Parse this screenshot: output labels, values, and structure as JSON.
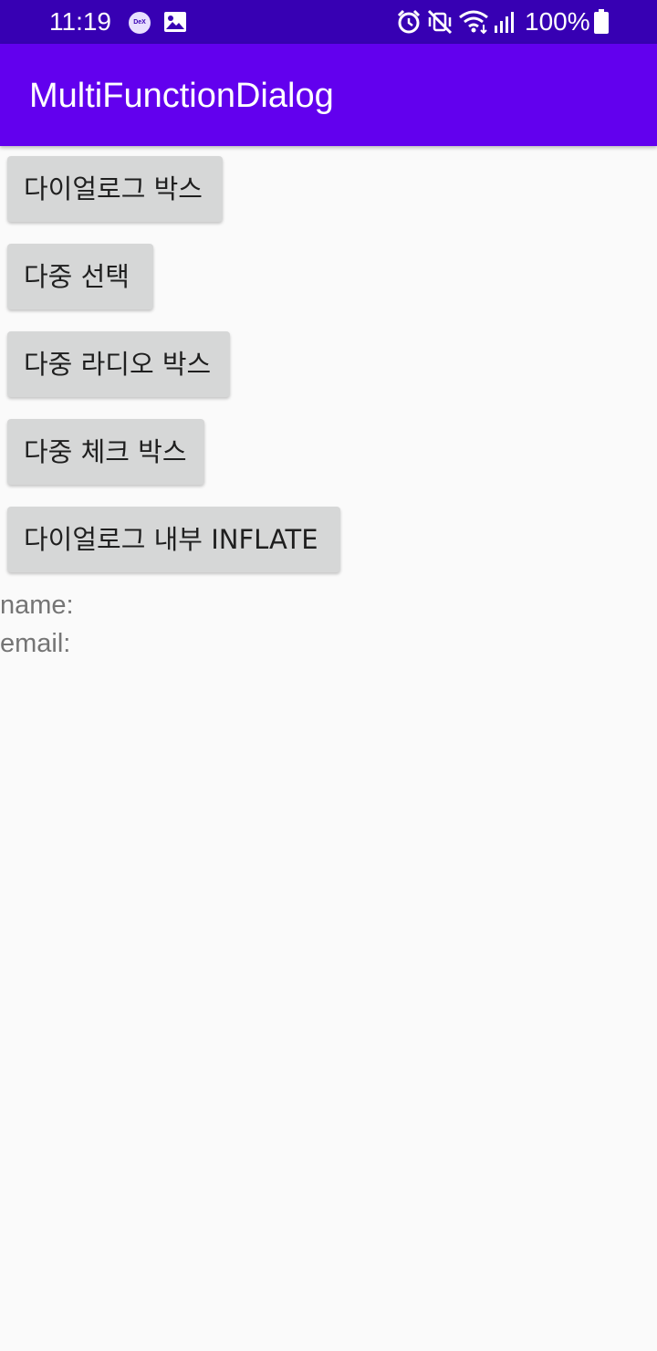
{
  "status_bar": {
    "time": "11:19",
    "dex_label": "DeX",
    "battery": "100%",
    "bg_color": "#3700b3"
  },
  "app_bar": {
    "title": "MultiFunctionDialog",
    "bg_color": "#6200ee"
  },
  "buttons": [
    {
      "label": "다이얼로그 박스"
    },
    {
      "label": "다중 선택"
    },
    {
      "label": "다중 라디오 박스"
    },
    {
      "label": "다중 체크 박스"
    },
    {
      "label": "다이얼로그 내부 INFLATE"
    }
  ],
  "info": {
    "name_label": "name:",
    "email_label": "email:"
  },
  "icons": [
    "dex-icon",
    "gallery-icon",
    "alarm-icon",
    "vibrate-mute-icon",
    "wifi-icon",
    "signal-icon",
    "battery-icon"
  ]
}
